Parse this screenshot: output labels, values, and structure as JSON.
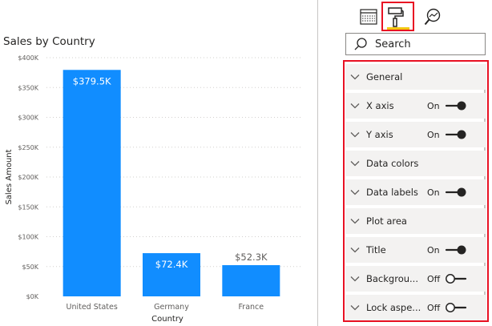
{
  "chart_data": {
    "type": "bar",
    "title": "Sales by Country",
    "xlabel": "Country",
    "ylabel": "Sales Amount",
    "categories": [
      "United States",
      "Germany",
      "France"
    ],
    "values": [
      379500,
      72400,
      52300
    ],
    "data_labels": [
      "$379.5K",
      "$72.4K",
      "$52.3K"
    ],
    "ylim": [
      0,
      400000
    ],
    "yticks": [
      0,
      50000,
      100000,
      150000,
      200000,
      250000,
      300000,
      350000,
      400000
    ],
    "ytick_labels": [
      "$0K",
      "$50K",
      "$100K",
      "$150K",
      "$200K",
      "$250K",
      "$300K",
      "$350K",
      "$400K"
    ],
    "grid": true,
    "bar_color": "#118dff"
  },
  "format_pane": {
    "tabs": [
      {
        "icon": "fields-grid-icon",
        "selected": false
      },
      {
        "icon": "paint-roller-icon",
        "selected": true
      },
      {
        "icon": "analytics-magnifier-icon",
        "selected": false
      }
    ],
    "search_label": "Search",
    "cards": [
      {
        "label": "General",
        "toggle": null
      },
      {
        "label": "X axis",
        "toggle": "On"
      },
      {
        "label": "Y axis",
        "toggle": "On"
      },
      {
        "label": "Data colors",
        "toggle": null
      },
      {
        "label": "Data labels",
        "toggle": "On"
      },
      {
        "label": "Plot area",
        "toggle": null
      },
      {
        "label": "Title",
        "toggle": "On"
      },
      {
        "label": "Backgrou...",
        "toggle": "Off"
      },
      {
        "label": "Lock aspe...",
        "toggle": "Off"
      }
    ],
    "colors": {
      "highlight": "#e81123",
      "accent": "#f2c811",
      "card_bg": "#f3f2f1"
    }
  }
}
